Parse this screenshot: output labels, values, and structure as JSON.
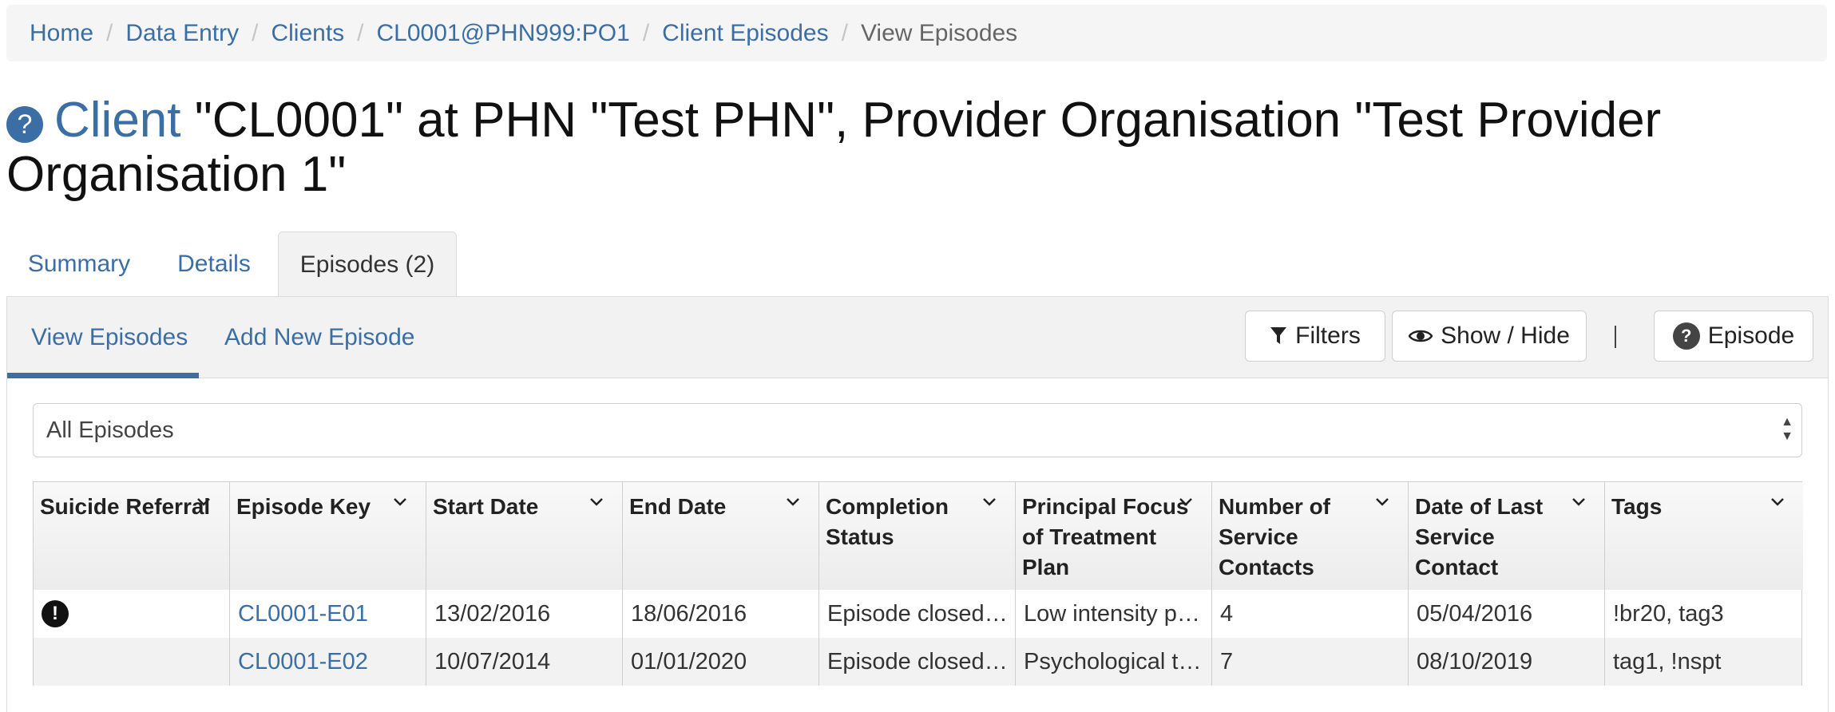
{
  "breadcrumb": {
    "items": [
      "Home",
      "Data Entry",
      "Clients",
      "CL0001@PHN999:PO1",
      "Client Episodes"
    ],
    "current": "View Episodes"
  },
  "title": {
    "help": "?",
    "client_word": "Client",
    "text": "\"CL0001\" at PHN \"Test PHN\", Provider Organisation \"Test Provider Organisation 1\""
  },
  "tabs": [
    "Summary",
    "Details",
    "Episodes (2)"
  ],
  "subtabs": [
    "View Episodes",
    "Add New Episode"
  ],
  "toolbar": {
    "filters": "Filters",
    "show_hide": "Show / Hide",
    "episode": "Episode",
    "help": "?"
  },
  "select": {
    "value": "All Episodes"
  },
  "table": {
    "headers": [
      "Suicide Referral",
      "Episode Key",
      "Start Date",
      "End Date",
      "Completion Status",
      "Principal Focus of Treatment Plan",
      "Number of Service Contacts",
      "Date of Last Service Contact",
      "Tags"
    ],
    "rows": [
      {
        "suicide_referral": "!",
        "episode_key": "CL0001-E01",
        "start_date": "13/02/2016",
        "end_date": "18/06/2016",
        "completion_status": "Episode closed ...",
        "principal_focus": "Low intensity ps...",
        "service_contacts": "4",
        "last_contact": "05/04/2016",
        "tags": "!br20, tag3"
      },
      {
        "suicide_referral": "",
        "episode_key": "CL0001-E02",
        "start_date": "10/07/2014",
        "end_date": "01/01/2020",
        "completion_status": "Episode closed ...",
        "principal_focus": "Psychological th...",
        "service_contacts": "7",
        "last_contact": "08/10/2019",
        "tags": "tag1, !nspt"
      }
    ]
  },
  "colors": {
    "accent": "#3a6ea5",
    "border": "#cfcfcf"
  }
}
